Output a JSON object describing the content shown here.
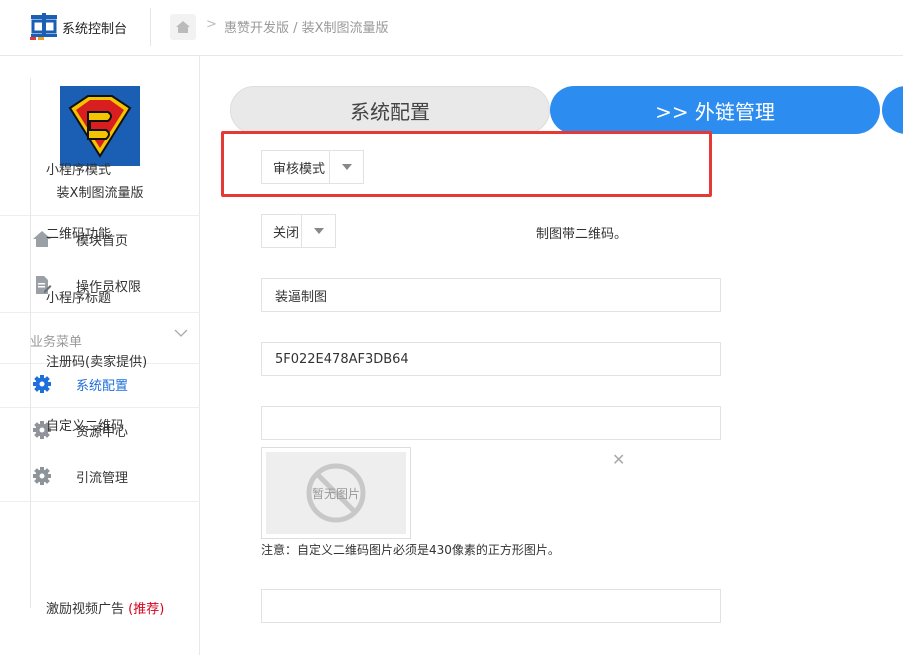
{
  "header": {
    "app_title": "系统控制台",
    "breadcrumb_sep": ">",
    "breadcrumb": "惠赞开发版 / 装X制图流量版"
  },
  "sidebar": {
    "brand_name": "装X制图流量版",
    "items": [
      {
        "label": "模块首页",
        "icon": "home-icon"
      },
      {
        "label": "操作员权限",
        "icon": "document-edit-icon"
      }
    ],
    "group": {
      "label": "业务菜单",
      "chevron": "chevron-down-icon"
    },
    "sub_items": [
      {
        "label": "系统配置",
        "icon": "gear-icon",
        "active": true
      },
      {
        "label": "资源中心",
        "icon": "gear-icon"
      },
      {
        "label": "引流管理",
        "icon": "gear-icon"
      }
    ]
  },
  "tabs": {
    "system_config": "系统配置",
    "link_manage": ">> 外链管理"
  },
  "form": {
    "mini_mode": {
      "label": "小程序模式",
      "value": "审核模式"
    },
    "qrcode": {
      "label": "二维码功能",
      "value": "关闭",
      "suffix": "制图带二维码。"
    },
    "title": {
      "label": "小程序标题",
      "value": "装逼制图"
    },
    "reg_code": {
      "label": "注册码(卖家提供)",
      "value": "5F022E478AF3DB64"
    },
    "custom_qr": {
      "label": "自定义二维码",
      "value": "",
      "no_image": "暂无图片",
      "close": "✕",
      "note": "注意：自定义二维码图片必须是430像素的正方形图片。"
    },
    "reward_ad": {
      "label": "激励视频广告 ",
      "label_red": "(推荐)",
      "value": ""
    }
  },
  "colors": {
    "accent": "#2d8cf0",
    "highlight": "#e53935",
    "active_nav": "#1e6fd9",
    "brand_bg": "#1a5fb4"
  }
}
